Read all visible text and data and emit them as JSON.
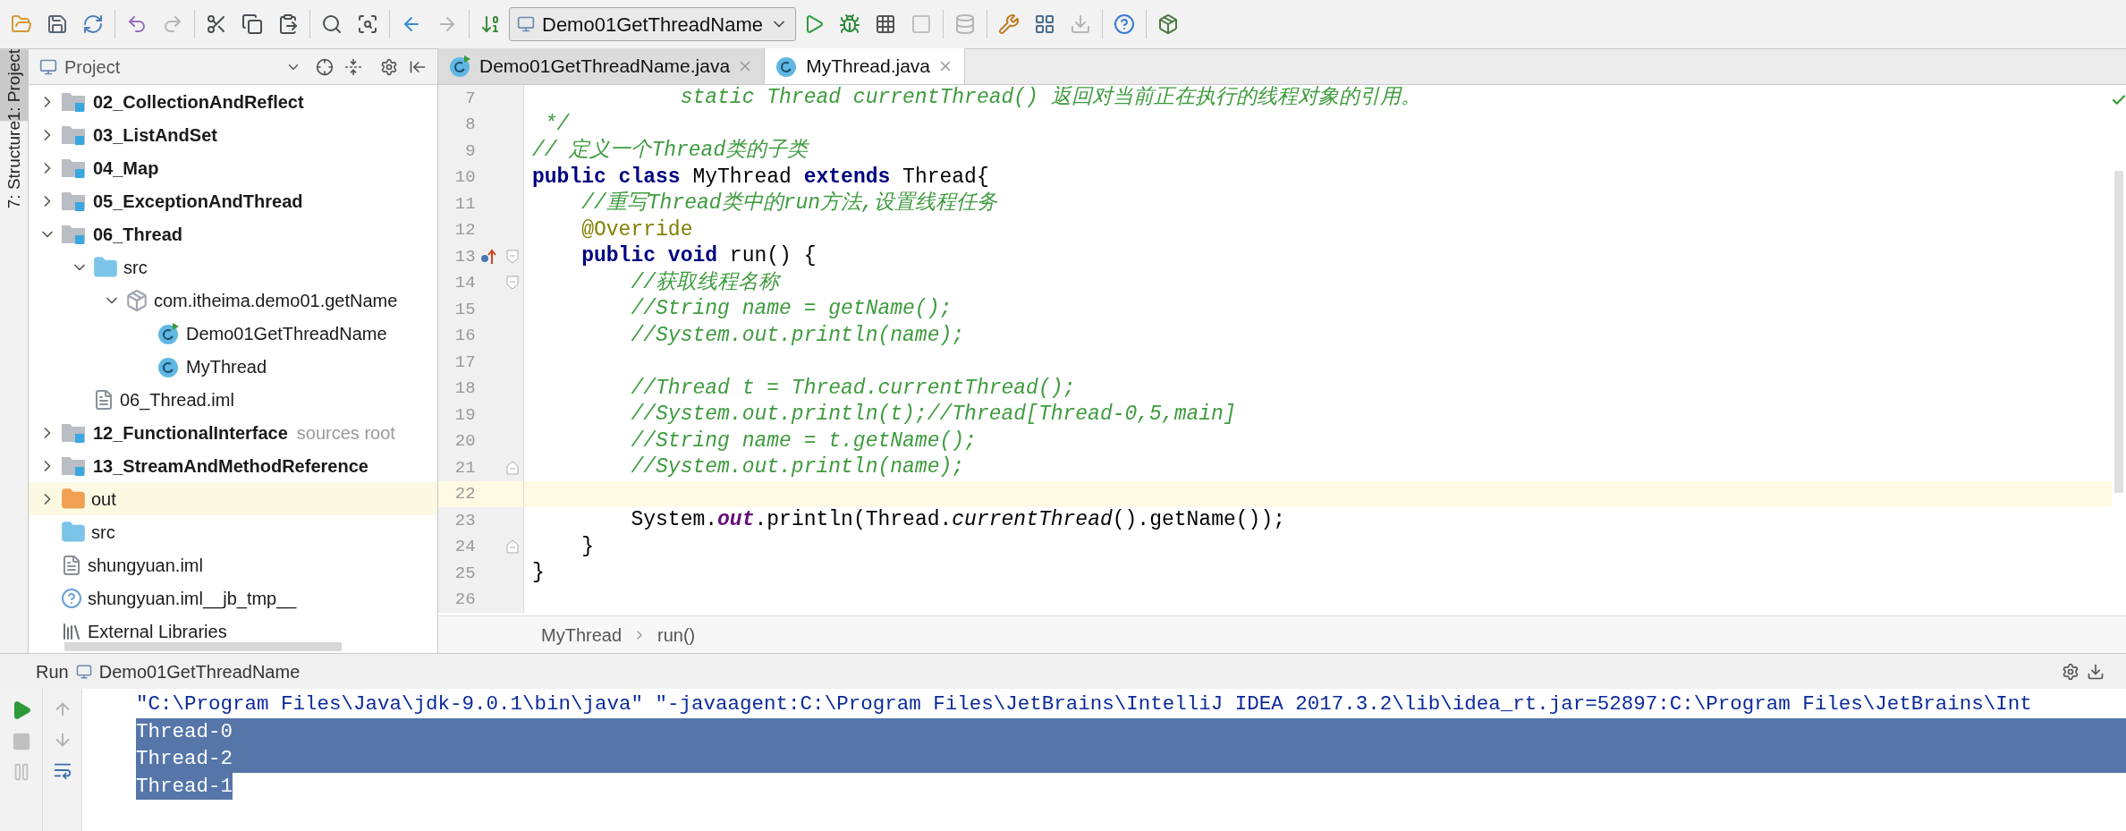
{
  "toolbar": {
    "run_config": "Demo01GetThreadName"
  },
  "side_tabs": [
    {
      "label": "1: Project",
      "selected": true
    },
    {
      "label": "7: Structure",
      "selected": false
    }
  ],
  "project_panel": {
    "title": "Project",
    "tree": [
      {
        "name": "02_CollectionAndReflect",
        "kind": "module",
        "expanded": false,
        "selected": false
      },
      {
        "name": "03_ListAndSet",
        "kind": "module",
        "expanded": false,
        "selected": false
      },
      {
        "name": "04_Map",
        "kind": "module",
        "expanded": false,
        "selected": false
      },
      {
        "name": "05_ExceptionAndThread",
        "kind": "module",
        "expanded": false,
        "selected": false
      },
      {
        "name": "06_Thread",
        "kind": "module",
        "expanded": true,
        "selected": false,
        "children": [
          {
            "name": "src",
            "kind": "source",
            "expanded": true,
            "selected": false,
            "children": [
              {
                "name": "com.itheima.demo01.getName",
                "kind": "package",
                "expanded": true,
                "selected": false,
                "children": [
                  {
                    "name": "Demo01GetThreadName",
                    "kind": "main-class",
                    "selected": false
                  },
                  {
                    "name": "MyThread",
                    "kind": "class",
                    "selected": false
                  }
                ]
              }
            ]
          },
          {
            "name": "06_Thread.iml",
            "kind": "iml",
            "selected": false
          }
        ]
      },
      {
        "name": "12_FunctionalInterface",
        "kind": "module",
        "expanded": false,
        "selected": false,
        "hint": "sources root"
      },
      {
        "name": "13_StreamAndMethodReference",
        "kind": "module",
        "expanded": false,
        "selected": false
      },
      {
        "name": "out",
        "kind": "excluded",
        "expanded": false,
        "selected": true
      },
      {
        "name": "src",
        "kind": "source",
        "selected": false
      },
      {
        "name": "shungyuan.iml",
        "kind": "iml",
        "selected": false
      },
      {
        "name": "shungyuan.iml__jb_tmp__",
        "kind": "unknown",
        "selected": false
      },
      {
        "name": "External Libraries",
        "kind": "library",
        "selected": false
      }
    ]
  },
  "editor": {
    "tabs": [
      {
        "label": "Demo01GetThreadName.java",
        "kind": "main-class",
        "selected": false
      },
      {
        "label": "MyThread.java",
        "kind": "class",
        "selected": true
      }
    ],
    "lines": [
      {
        "number": "7",
        "current": false,
        "tokens": [
          {
            "kind": "comment",
            "text": "            static Thread currentThread() 返回对当前正在执行的线程对象的引用。"
          }
        ]
      },
      {
        "number": "8",
        "current": false,
        "tokens": [
          {
            "kind": "comment",
            "text": " */"
          }
        ]
      },
      {
        "number": "9",
        "current": false,
        "tokens": [
          {
            "kind": "comment",
            "text": "// 定义一个Thread类的子类"
          }
        ]
      },
      {
        "number": "10",
        "current": false,
        "tokens": [
          {
            "kind": "keyword",
            "text": "public class "
          },
          {
            "kind": "plain",
            "text": "MyThread "
          },
          {
            "kind": "keyword",
            "text": "extends "
          },
          {
            "kind": "plain",
            "text": "Thread{"
          }
        ]
      },
      {
        "number": "11",
        "current": false,
        "tokens": [
          {
            "kind": "comment",
            "text": "    //重写Thread类中的run方法,设置线程任务"
          }
        ]
      },
      {
        "number": "12",
        "current": false,
        "tokens": [
          {
            "kind": "annotation",
            "text": "    @Override"
          }
        ]
      },
      {
        "number": "13",
        "current": false,
        "gutter_icons": [
          {
            "kind": "override"
          },
          {
            "kind": "fold-start"
          }
        ],
        "tokens": [
          {
            "kind": "keyword",
            "text": "    public void "
          },
          {
            "kind": "plain",
            "text": "run() {"
          }
        ]
      },
      {
        "number": "14",
        "current": false,
        "gutter_icons": [
          {
            "kind": "fold-start"
          }
        ],
        "tokens": [
          {
            "kind": "comment",
            "text": "        //获取线程名称"
          }
        ]
      },
      {
        "number": "15",
        "current": false,
        "tokens": [
          {
            "kind": "comment",
            "text": "        //String name = getName();"
          }
        ]
      },
      {
        "number": "16",
        "current": false,
        "tokens": [
          {
            "kind": "comment",
            "text": "        //System.out.println(name);"
          }
        ]
      },
      {
        "number": "17",
        "current": false
      },
      {
        "number": "18",
        "current": false,
        "tokens": [
          {
            "kind": "comment",
            "text": "        //Thread t = Thread.currentThread();"
          }
        ]
      },
      {
        "number": "19",
        "current": false,
        "tokens": [
          {
            "kind": "comment",
            "text": "        //System.out.println(t);//Thread[Thread-0,5,main]"
          }
        ]
      },
      {
        "number": "20",
        "current": false,
        "tokens": [
          {
            "kind": "comment",
            "text": "        //String name = t.getName();"
          }
        ]
      },
      {
        "number": "21",
        "current": false,
        "gutter_icons": [
          {
            "kind": "fold-end"
          }
        ],
        "tokens": [
          {
            "kind": "comment",
            "text": "        //System.out.println(name);"
          }
        ]
      },
      {
        "number": "22",
        "current": true
      },
      {
        "number": "23",
        "current": false,
        "tokens": [
          {
            "kind": "plain",
            "text": "        System."
          },
          {
            "kind": "field",
            "text": "out"
          },
          {
            "kind": "plain",
            "text": ".println(Thread."
          },
          {
            "kind": "static",
            "text": "currentThread"
          },
          {
            "kind": "plain",
            "text": "().getName());"
          }
        ]
      },
      {
        "number": "24",
        "current": false,
        "gutter_icons": [
          {
            "kind": "fold-end"
          }
        ],
        "tokens": [
          {
            "kind": "plain",
            "text": "    }"
          }
        ]
      },
      {
        "number": "25",
        "current": false,
        "tokens": [
          {
            "kind": "plain",
            "text": "}"
          }
        ]
      },
      {
        "number": "26",
        "current": false
      }
    ],
    "breadcrumbs": [
      "MyThread",
      "run()"
    ]
  },
  "run_panel": {
    "label": "Run",
    "config": "Demo01GetThreadName",
    "lines": [
      {
        "text": "\"C:\\Program Files\\Java\\jdk-9.0.1\\bin\\java\" \"-javaagent:C:\\Program Files\\JetBrains\\IntelliJ IDEA 2017.3.2\\lib\\idea_rt.jar=52897:C:\\Program Files\\JetBrains\\Int",
        "selected": false
      },
      {
        "text": "Thread-0",
        "selected": true
      },
      {
        "text": "Thread-2",
        "selected": true
      },
      {
        "text": "Thread-1",
        "selected": true
      }
    ]
  }
}
